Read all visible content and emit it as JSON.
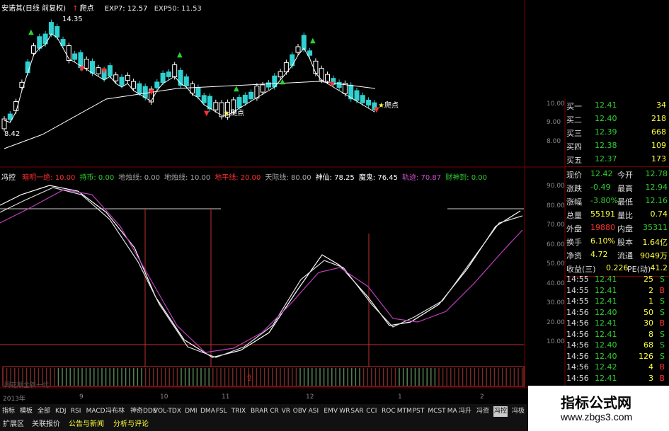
{
  "header": {
    "title": "安诺其(日线 前复权)",
    "signal": "爬点",
    "exp7": "EXP7: 12.57",
    "exp50": "EXP50: 11.53"
  },
  "price_chart": {
    "high_label": "14.35",
    "low_label": "8.42",
    "signal_labels": [
      "爬点",
      "爬点"
    ],
    "y_ticks": [
      "10.00",
      "9.00",
      "8.00"
    ]
  },
  "indicator": {
    "name": "冯控",
    "params": [
      {
        "text": "暗明一绝: 10.00",
        "color": "#ff3030"
      },
      {
        "text": "持币: 0.00",
        "color": "#30d030"
      },
      {
        "text": "地烛线: 0.00",
        "color": "#aaaaaa"
      },
      {
        "text": "地烛线: 10.00",
        "color": "#aaaaaa"
      },
      {
        "text": "地平线: 20.00",
        "color": "#ff3030"
      },
      {
        "text": "天际线: 80.00",
        "color": "#aaaaaa"
      },
      {
        "text": "神仙: 78.25",
        "color": "#ffffff"
      },
      {
        "text": "魔鬼: 76.45",
        "color": "#ffffff"
      },
      {
        "text": "轨迹: 70.87",
        "color": "#d050d0"
      },
      {
        "text": "财神到: 0.00",
        "color": "#30d030"
      }
    ],
    "y_ticks": [
      "90.00",
      "80.00",
      "70.00",
      "60.00",
      "50.00",
      "40.00",
      "30.00",
      "20.00",
      "10.00"
    ],
    "watermark": "同花顺全新一代"
  },
  "x_axis": {
    "labels": [
      "2013年",
      "9",
      "10",
      "11",
      "12",
      "1",
      "2"
    ]
  },
  "quote": {
    "bids": [
      {
        "label": "买一",
        "price": "12.41",
        "vol": "34"
      },
      {
        "label": "买二",
        "price": "12.40",
        "vol": "218"
      },
      {
        "label": "买三",
        "price": "12.39",
        "vol": "668"
      },
      {
        "label": "买四",
        "price": "12.38",
        "vol": "109"
      },
      {
        "label": "买五",
        "price": "12.37",
        "vol": "173"
      }
    ],
    "stats": [
      {
        "l1": "现价",
        "v1": "12.42",
        "c1": "#30d030",
        "l2": "今开",
        "v2": "12.78",
        "c2": "#30d030"
      },
      {
        "l1": "涨跌",
        "v1": "-0.49",
        "c1": "#30d030",
        "l2": "最高",
        "v2": "12.94",
        "c2": "#30d030"
      },
      {
        "l1": "涨幅",
        "v1": "-3.80%",
        "c1": "#30d030",
        "l2": "最低",
        "v2": "12.16",
        "c2": "#30d030"
      },
      {
        "l1": "总量",
        "v1": "55191",
        "c1": "#ffff40",
        "l2": "量比",
        "v2": "0.74",
        "c2": "#ffff40"
      },
      {
        "l1": "外盘",
        "v1": "19880",
        "c1": "#ff3030",
        "l2": "内盘",
        "v2": "35311",
        "c2": "#30d030"
      },
      {
        "l1": "换手",
        "v1": "6.10%",
        "c1": "#ffff40",
        "l2": "股本",
        "v2": "1.64亿",
        "c2": "#ffff40"
      },
      {
        "l1": "净资",
        "v1": "4.72",
        "c1": "#ffff40",
        "l2": "流通",
        "v2": "9049万",
        "c2": "#ffff40"
      },
      {
        "l1": "收益(三)",
        "v1": "0.226",
        "c1": "#ffff40",
        "l2": "PE(动)",
        "v2": "41.2",
        "c2": "#ffff40"
      }
    ],
    "ticks": [
      {
        "time": "14:55",
        "price": "12.41",
        "vol": "25",
        "dir": "S"
      },
      {
        "time": "14:55",
        "price": "12.41",
        "vol": "2",
        "dir": "B"
      },
      {
        "time": "14:55",
        "price": "12.41",
        "vol": "1",
        "dir": "S"
      },
      {
        "time": "14:56",
        "price": "12.40",
        "vol": "50",
        "dir": "S"
      },
      {
        "time": "14:56",
        "price": "12.41",
        "vol": "30",
        "dir": "B"
      },
      {
        "time": "14:56",
        "price": "12.41",
        "vol": "8",
        "dir": "S"
      },
      {
        "time": "14:56",
        "price": "12.40",
        "vol": "68",
        "dir": "S"
      },
      {
        "time": "14:56",
        "price": "12.40",
        "vol": "126",
        "dir": "S"
      },
      {
        "time": "14:56",
        "price": "12.42",
        "vol": "4",
        "dir": "B"
      },
      {
        "time": "14:56",
        "price": "12.41",
        "vol": "3",
        "dir": "B"
      }
    ]
  },
  "tabs": [
    "指标",
    "模板",
    "全部",
    "KDJ",
    "RSI",
    "MACD",
    "冯布林",
    "神奇DDE",
    "VOL-TDX",
    "DMI",
    "DMA",
    "FSL",
    "TRIX",
    "BRAR",
    "CR",
    "VR",
    "OBV",
    "ASI",
    "EMV",
    "WR",
    "SAR",
    "CCI",
    "ROC",
    "MTM",
    "PST",
    "MCST",
    "MA",
    "冯升",
    "冯资",
    "冯控",
    "冯极"
  ],
  "active_tab": "冯控",
  "bottom_tabs": [
    {
      "text": "扩展区",
      "color": "#dddddd"
    },
    {
      "text": "关联报价",
      "color": "#dddddd"
    },
    {
      "text": "公告与新闻",
      "color": "#ffff40"
    },
    {
      "text": "分析与评论",
      "color": "#ffff40"
    }
  ],
  "watermark": {
    "title": "指标公式网",
    "url": "www.zbgs3.com"
  },
  "colors": {
    "up": "#ff3030",
    "down": "#30d0d0",
    "green": "#30d030",
    "purple": "#c040c0"
  }
}
